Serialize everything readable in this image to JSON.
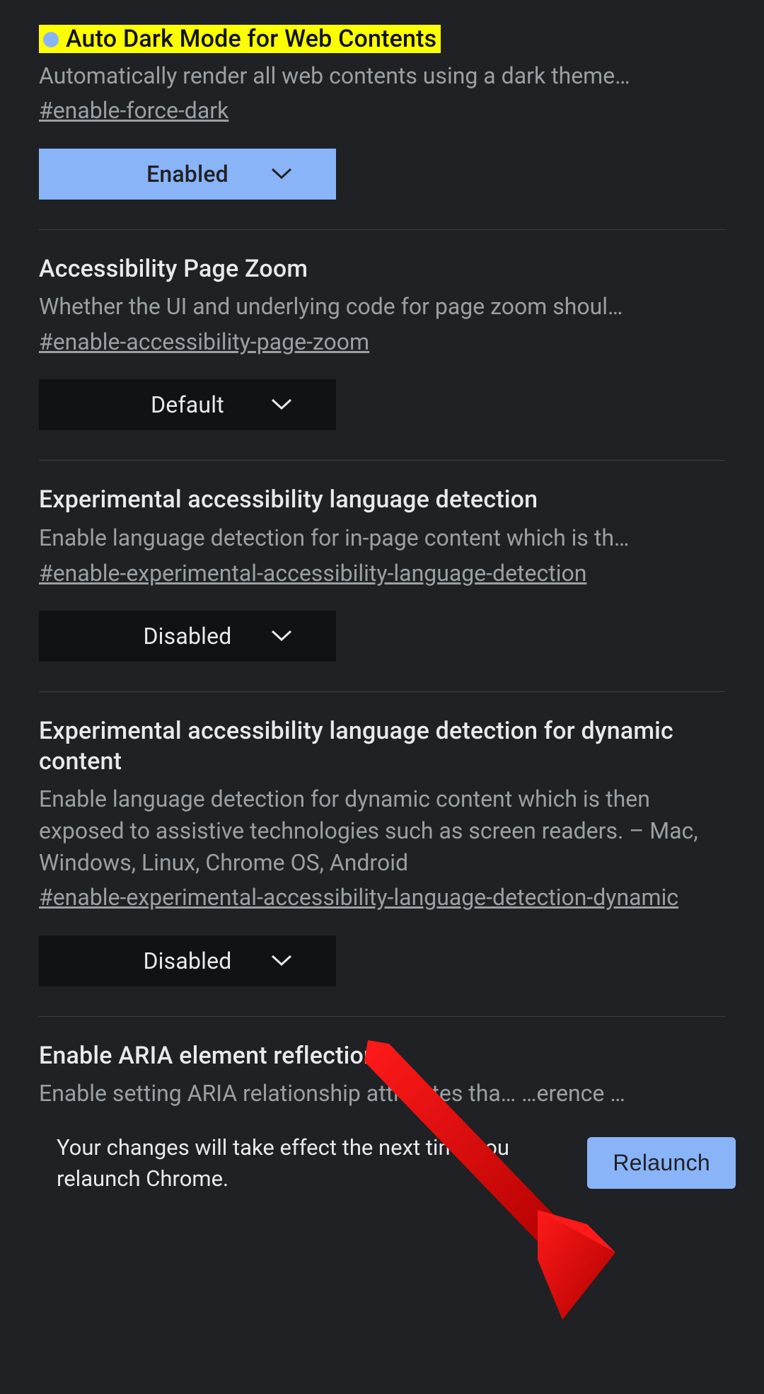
{
  "flags": [
    {
      "title": "Auto Dark Mode for Web Contents",
      "highlighted": true,
      "dot": true,
      "desc": "Automatically render all web contents using a dark theme…",
      "desc_mode": "ellipsis",
      "hash": "#enable-force-dark",
      "select": "Enabled",
      "select_state": "enabled"
    },
    {
      "title": "Accessibility Page Zoom",
      "desc": "Whether the UI and underlying code for page zoom shoul…",
      "desc_mode": "ellipsis",
      "hash": "#enable-accessibility-page-zoom",
      "select": "Default",
      "select_state": "default"
    },
    {
      "title": "Experimental accessibility language detection",
      "desc": "Enable language detection for in-page content which is th…",
      "desc_mode": "ellipsis",
      "hash": "#enable-experimental-accessibility-language-detection",
      "select": "Disabled",
      "select_state": "default"
    },
    {
      "title": "Experimental accessibility language detection for dynamic content",
      "desc": "Enable language detection for dynamic content which is then exposed to assistive technologies such as screen readers. – Mac, Windows, Linux, Chrome OS, Android",
      "desc_mode": "multiline",
      "hash": "#enable-experimental-accessibility-language-detection-dynamic",
      "select": "Disabled",
      "select_state": "default"
    },
    {
      "title": "Enable ARIA element reflection",
      "desc": "Enable setting ARIA relationship attributes tha…   …erence …",
      "desc_mode": "ellipsis",
      "partial": true
    }
  ],
  "footer": {
    "text": "Your changes will take effect the next time you relaunch Chrome.",
    "button": "Relaunch"
  }
}
